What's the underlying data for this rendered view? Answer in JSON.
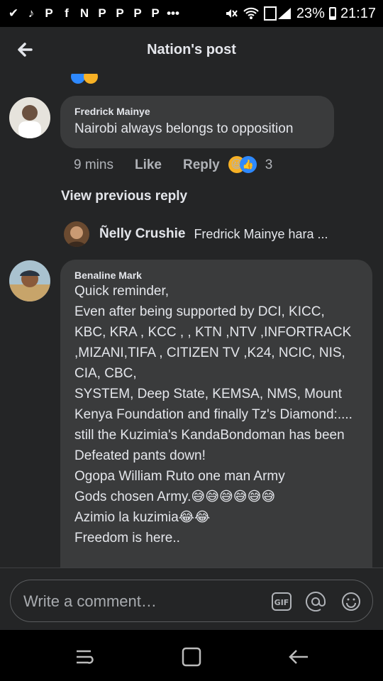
{
  "status_bar": {
    "left_icons": [
      "✔",
      "♪",
      "P",
      "f",
      "N",
      "P",
      "P",
      "P",
      "P",
      "•••"
    ],
    "battery": "23%",
    "time": "21:17"
  },
  "header": {
    "title": "Nation's post"
  },
  "comments": [
    {
      "author": "Fredrick Mainye",
      "text": "Nairobi always belongs to opposition",
      "time": "9 mins",
      "like_label": "Like",
      "reply_label": "Reply",
      "reaction_count": "3"
    },
    {
      "author": "Benaline Mark",
      "text": "Quick reminder,\nEven after being supported by DCI, KICC, KBC, KRA ,  KCC , , KTN ,NTV ,INFORTRACK ,MIZANI,TIFA , CITIZEN TV ,K24, NCIC, NIS, CIA, CBC,\nSYSTEM, Deep State, KEMSA, NMS, Mount Kenya Foundation and finally Tz's Diamond:.... still the Kuzimia's KandaBondoman has been Defeated pants down!\nOgopa William Ruto one man Army\nGods chosen Army.😅😅😅😅😅😅\nAzimio la kuzimia😂😂\nFreedom is here.."
    }
  ],
  "view_previous": "View previous reply",
  "inline_reply": {
    "author": "Ñelly Crushie",
    "snippet": "Fredrick Mainye hara ..."
  },
  "composer": {
    "placeholder": "Write a comment…",
    "gif_label": "GIF"
  },
  "colors": {
    "background": "#242526",
    "bubble": "#3a3b3c",
    "like_blue": "#2e89ff"
  }
}
